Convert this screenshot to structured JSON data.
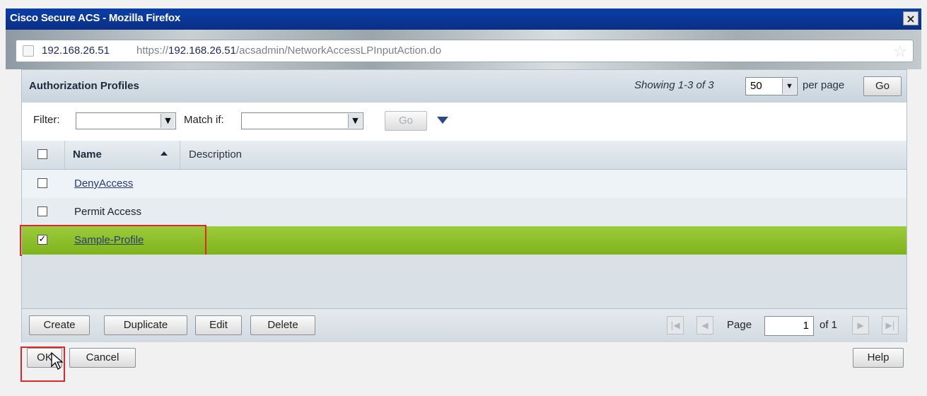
{
  "window": {
    "title": "Cisco Secure ACS - Mozilla Firefox",
    "close_glyph": "×"
  },
  "address_bar": {
    "host": "192.168.26.51",
    "url_prefix": "https://",
    "url_host": "192.168.26.51",
    "url_path": "/acsadmin/NetworkAccessLPInputAction.do",
    "star_glyph": "☆"
  },
  "panel": {
    "title": "Authorization Profiles",
    "showing": "Showing 1-3 of 3",
    "per_page_value": "50",
    "per_page_label": "per page",
    "go_label": "Go"
  },
  "filter": {
    "filter_label": "Filter:",
    "filter_value": "",
    "match_label": "Match if:",
    "match_value": "",
    "go_label": "Go"
  },
  "table": {
    "columns": {
      "name": "Name",
      "description": "Description"
    },
    "rows": [
      {
        "name": "DenyAccess",
        "description": "",
        "checked": false,
        "link": true
      },
      {
        "name": "Permit Access",
        "description": "",
        "checked": false,
        "link": false
      },
      {
        "name": "Sample-Profile",
        "description": "",
        "checked": true,
        "link": true
      }
    ]
  },
  "footer": {
    "create_label": "Create",
    "duplicate_label": "Duplicate",
    "edit_label": "Edit",
    "delete_label": "Delete",
    "page_label": "Page",
    "page_value": "1",
    "of_label": "of 1"
  },
  "dialog": {
    "ok_label": "OK",
    "cancel_label": "Cancel",
    "help_label": "Help"
  },
  "colors": {
    "title_bar": "#0b3a9c",
    "selected_row": "#8dbf2a",
    "highlight_box": "#e0282a",
    "link": "#2a3b6e"
  }
}
